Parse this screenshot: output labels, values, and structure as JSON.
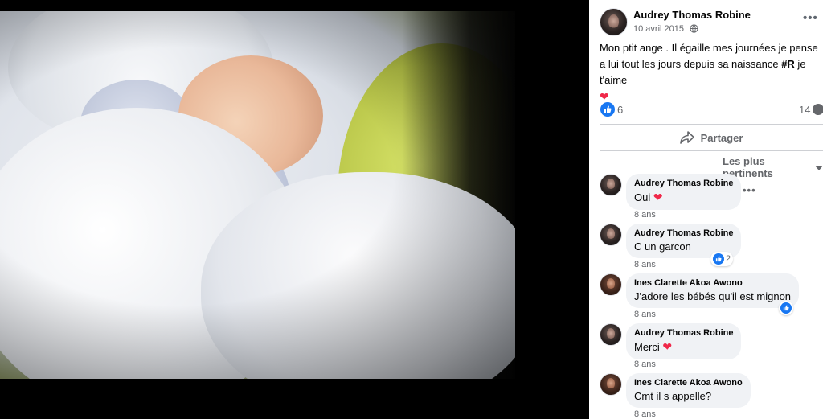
{
  "post": {
    "author": "Audrey Thomas Robine",
    "date": "10 avril 2015",
    "more_label": "•••",
    "text_before": "Mon ptit ange . Il égaille mes journées je pense a lui tout les jours depuis sa naissance ",
    "hashtag": "#R",
    "text_after": " je t'aime",
    "text_emoji": "❤",
    "like_count": "6",
    "comment_count": "14",
    "share_label": "Partager",
    "sort_label": "Les plus pertinents"
  },
  "comments": [
    {
      "author": "Audrey Thomas Robine",
      "text": "Oui",
      "emoji": "❤",
      "time": "8 ans",
      "more_label": "•••"
    },
    {
      "author": "Audrey Thomas Robine",
      "text": "C un garcon",
      "emoji": "",
      "time": "8 ans",
      "likes": "2"
    },
    {
      "author": "Ines Clarette Akoa Awono",
      "text": "J'adore les bébés qu'il est mignon",
      "emoji": "",
      "time": "8 ans"
    },
    {
      "author": "Audrey Thomas Robine",
      "text": "Merci",
      "emoji": "❤",
      "time": "8 ans"
    },
    {
      "author": "Ines Clarette Akoa Awono",
      "text": "Cmt il s appelle?",
      "emoji": "",
      "time": "8 ans"
    }
  ],
  "colors": {
    "accent": "#1877f2",
    "heart": "#f02849",
    "bubble": "#f0f2f5",
    "secondary_text": "#65676b"
  },
  "icons": {
    "globe": "globe-icon",
    "like": "like-icon",
    "share": "share-icon",
    "comment": "comment-icon",
    "sort": "chevron-down-icon"
  }
}
